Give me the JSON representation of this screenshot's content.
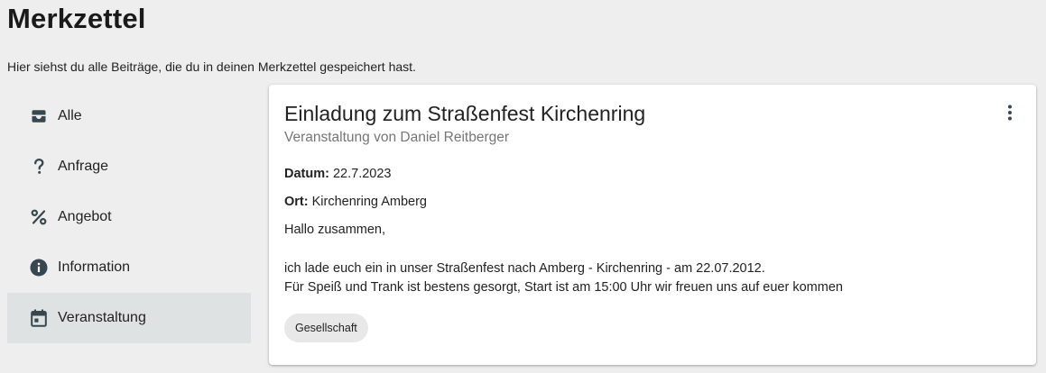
{
  "page": {
    "title": "Merkzettel",
    "subtitle": "Hier siehst du alle Beiträge, die du in deinen Merkzettel gespeichert hast."
  },
  "sidebar": {
    "items": [
      {
        "label": "Alle",
        "icon": "inbox-icon",
        "active": false
      },
      {
        "label": "Anfrage",
        "icon": "question-mark-icon",
        "active": false
      },
      {
        "label": "Angebot",
        "icon": "percent-icon",
        "active": false
      },
      {
        "label": "Information",
        "icon": "info-icon",
        "active": false
      },
      {
        "label": "Veranstaltung",
        "icon": "calendar-icon",
        "active": true
      }
    ],
    "active_background": "#dfe2e3"
  },
  "post": {
    "title": "Einladung zum Straßenfest Kirchenring",
    "subtitle": "Veranstaltung von Daniel Reitberger",
    "date_label": "Datum:",
    "date_value": "22.7.2023",
    "place_label": "Ort:",
    "place_value": "Kirchenring Amberg",
    "greeting": "Hallo zusammen,",
    "body_line_1": "ich lade euch ein in unser Straßenfest nach Amberg - Kirchenring - am 22.07.2012.",
    "body_line_2": "Für Speiß und Trank ist bestens gesorgt, Start ist am 15:00 Uhr wir freuen uns auf euer kommen",
    "tag": "Gesellschaft",
    "menu_icon": "more-vertical-icon"
  },
  "colors": {
    "background": "#eeeeee",
    "card": "#ffffff",
    "icon": "#37474f",
    "chip": "#e8e8e8"
  }
}
